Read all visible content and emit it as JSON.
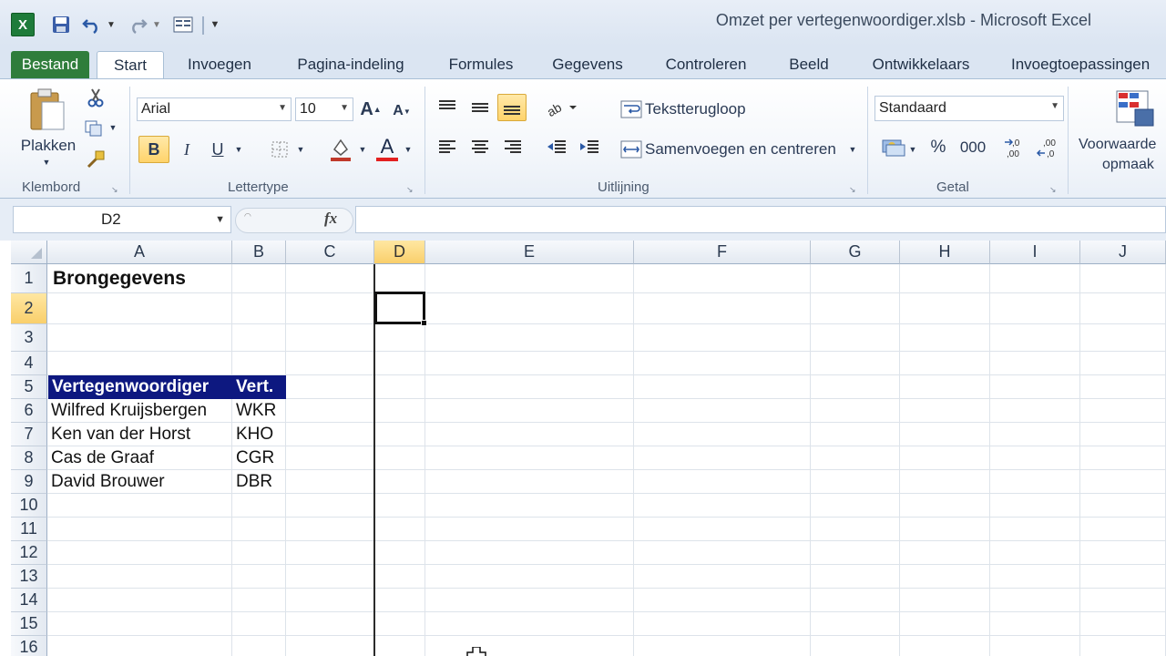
{
  "app": {
    "icon_letter": "X",
    "title": "Omzet per vertegenwoordiger.xlsb  -  Microsoft Excel"
  },
  "tabs": [
    "Bestand",
    "Start",
    "Invoegen",
    "Pagina-indeling",
    "Formules",
    "Gegevens",
    "Controleren",
    "Beeld",
    "Ontwikkelaars",
    "Invoegtoepassingen"
  ],
  "ribbon": {
    "clipboard": {
      "paste_label": "Plakken",
      "group_label": "Klembord"
    },
    "font": {
      "name": "Arial",
      "size": "10",
      "group_label": "Lettertype",
      "bold": "B",
      "italic": "I",
      "underline": "U"
    },
    "alignment": {
      "wrap_label": "Tekstterugloop",
      "merge_label": "Samenvoegen en centreren",
      "group_label": "Uitlijning"
    },
    "number": {
      "format": "Standaard",
      "percent": "%",
      "thousands": "000",
      "group_label": "Getal"
    },
    "styles": {
      "conditional_line1": "Voorwaarde",
      "conditional_line2": "opmaak"
    }
  },
  "formula_bar": {
    "name_box": "D2",
    "fx": "fx",
    "content": ""
  },
  "columns": [
    "A",
    "B",
    "C",
    "D",
    "E",
    "F",
    "G",
    "H",
    "I",
    "J"
  ],
  "selected_column": "D",
  "rows": [
    "1",
    "2",
    "3",
    "4",
    "5",
    "6",
    "7",
    "8",
    "9",
    "10",
    "11",
    "12",
    "13",
    "14",
    "15",
    "16"
  ],
  "selected_row": "2",
  "cells": {
    "a1": "Brongegevens",
    "a5": "Vertegenwoordiger",
    "b5": "Vert.",
    "a6": "Wilfred Kruijsbergen",
    "b6": "WKR",
    "a7": "Ken van der Horst",
    "b7": "KHO",
    "a8": "Cas de Graaf",
    "b8": "CGR",
    "a9": "David Brouwer",
    "b9": "DBR"
  },
  "colors": {
    "header_fill": "#0d1880",
    "ribbon_file_tab": "#2f7d3b",
    "selection_highlight": "#f9cf6b"
  }
}
